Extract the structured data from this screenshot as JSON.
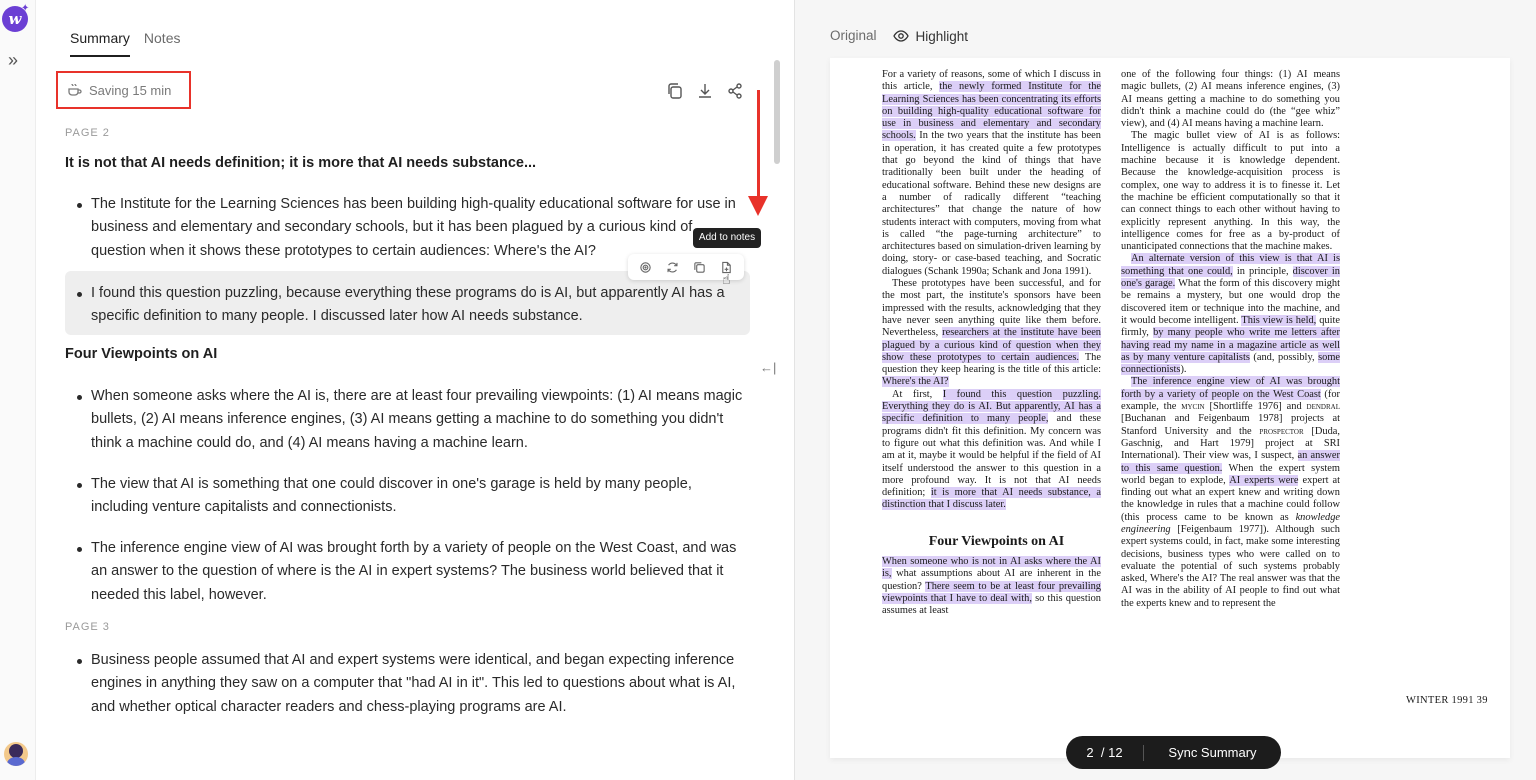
{
  "tabs": [
    {
      "label": "Summary",
      "active": true
    },
    {
      "label": "Notes",
      "active": false
    }
  ],
  "saving": "Saving 15 min",
  "tooltip": "Add to notes",
  "summary": {
    "page2_label": "PAGE 2",
    "heading1": "It is not that AI needs definition; it is more that AI needs substance...",
    "bullets1": [
      "The Institute for the Learning Sciences has been building high-quality educational software for use in business and elementary and secondary schools, but it has been plagued by a curious kind of question when it shows these prototypes to certain audiences: Where's the AI?",
      "I found this question puzzling, because everything these programs do is AI, but apparently AI has a specific definition to many people. I discussed later how AI needs substance."
    ],
    "heading2": "Four Viewpoints on AI",
    "bullets2": [
      "When someone asks where the AI is, there are at least four prevailing viewpoints: (1) AI means magic bullets, (2) AI means inference engines, (3) AI means getting a machine to do something you didn't think a machine could do, and (4) AI means having a machine learn.",
      "The view that AI is something that one could discover in one's garage is held by many people, including venture capitalists and connectionists.",
      "The inference engine view of AI was brought forth by a variety of people on the West Coast, and was an answer to the question of where is the AI in expert systems? The business world believed that it needed this label, however."
    ],
    "page3_label": "PAGE 3",
    "bullets3": [
      "Business people assumed that AI and expert systems were identical, and began expecting inference engines in anything they saw on a computer that \"had AI in it\". This led to questions about what is AI, and whether optical character readers and chess-playing programs are AI."
    ]
  },
  "original_tabs": {
    "original": "Original",
    "highlight": "Highlight"
  },
  "paper": {
    "left": {
      "p1_a": "For a variety of reasons, some of which I discuss in this article, ",
      "p1_m1": "the newly formed Institute for the Learning Sciences has been concentrating its efforts on building high-quality educational software for use in business and elementary and secondary schools.",
      "p1_b": " In the two years that the institute has been in operation, it has created quite a few prototypes that go beyond the kind of things that have traditionally been built under the heading of educational software. Behind these new designs are a number of radically different “teaching architectures” that change the nature of how students interact with computers, moving from what is called “the page-turning architecture” to architectures based on simulation-driven learning by doing, story- or case-based teaching, and Socratic dialogues (Schank 1990a; Schank and Jona 1991).",
      "p2_a": "These prototypes have been successful, and for the most part, the institute's sponsors have been impressed with the results, acknowledging that they have never seen anything quite like them before. Nevertheless, ",
      "p2_m1": "researchers at the institute have been plagued by a curious kind of question when they show these prototypes to certain audiences.",
      "p2_b": " The question they keep hearing is the title of this article: ",
      "p2_m2": "Where's the AI?",
      "p3_a": "At first, ",
      "p3_m1": "I found this question puzzling. Everything they do is AI. But apparently, AI has a specific definition to many people,",
      "p3_b": " and these programs didn't fit this definition. My concern was to figure out what this definition was. And while I am at it, maybe it would be helpful if the field of AI itself understood the answer to this question in a more profound way. It is not that AI needs definition; ",
      "p3_m2": "it is more that AI needs substance, a distinction that I discuss later.",
      "heading": "Four Viewpoints on AI",
      "p4_m1": "When someone who is not in AI asks where the AI is,",
      "p4_a": " what assumptions about AI are inherent in the question? ",
      "p4_m2": "There seem to be at least four prevailing viewpoints that I have to deal with,",
      "p4_b": " so this question assumes at least"
    },
    "right": {
      "p1": "one of the following four things: (1) AI means magic bullets, (2) AI means inference engines, (3) AI means getting a machine to do something you didn't think a machine could do (the “gee whiz” view), and (4) AI means having a machine learn.",
      "p2": "The magic bullet view of AI is as follows: Intelligence is actually difficult to put into a machine because it is knowledge dependent. Because the knowledge-acquisition process is complex, one way to address it is to finesse it. Let the machine be efficient computationally so that it can connect things to each other without having to explicitly represent anything. In this way, the intelligence comes for free as a by-product of unanticipated connections that the machine makes.",
      "p3_m1": "An alternate version of this view is that AI is something that one could,",
      "p3_a": " in principle, ",
      "p3_m2": "discover in one's garage.",
      "p3_b": " What the form of this discovery might be remains a mystery, but one would drop the discovered item or technique into the machine, and it would become intelligent. ",
      "p3_m3": "This view is held,",
      "p3_c": " quite firmly, ",
      "p3_m4": "by many people who write me letters after having read my name in a magazine article as well as by many venture capitalists",
      "p3_d": " (and, possibly, ",
      "p3_m5": "some connectionists",
      "p3_e": ").",
      "p4_m1": "The inference engine view of AI was brought forth by a variety of people on the West Coast",
      "p4_a": " (for example, the ",
      "p4_sc1": "mycin",
      "p4_b": " [Shortliffe 1976] and ",
      "p4_sc2": "dendral",
      "p4_c": " [Buchanan and Feigenbaum 1978] projects at Stanford University and the ",
      "p4_sc3": "prospector",
      "p4_d": " [Duda, Gaschnig, and Hart 1979] project at SRI International). Their view was, I suspect, ",
      "p4_m2": "an answer to this same question.",
      "p4_e": " When the expert system world began to explode, ",
      "p4_m3": "AI experts were",
      "p4_f": " expert at finding out what an expert knew and writing down the knowledge in rules that a machine could follow (this process came to be known as ",
      "p4_i": "knowledge engineering",
      "p4_g": " [Feigenbaum 1977]). Although such expert systems could, in fact, make some interesting decisions, business types who were called on to evaluate the potential of such systems probably asked, Where's the AI? The real answer was that the AI was in the ability of AI people to find out what the experts knew and to represent the"
    },
    "footer": "WINTER 1991    39"
  },
  "pager": {
    "current": "2",
    "total": "/ 12",
    "sync": "Sync Summary"
  }
}
